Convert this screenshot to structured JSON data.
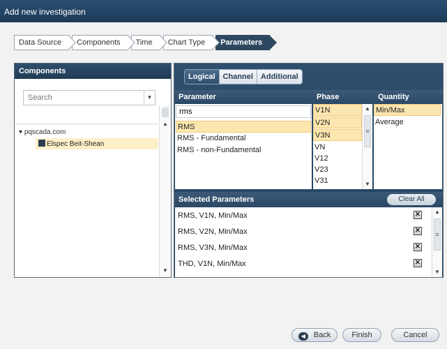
{
  "window": {
    "title": "Add new investigation"
  },
  "wizard": {
    "steps": [
      "Data Source",
      "Components",
      "Time",
      "Chart Type",
      "Parameters"
    ]
  },
  "components": {
    "title": "Components",
    "search_placeholder": "Search",
    "tree_root": "pqscada.com",
    "tree_child": "Elspec Beit-Shean"
  },
  "tabs": [
    "Logical",
    "Channel",
    "Additional"
  ],
  "grid": {
    "headers": {
      "parameter": "Parameter",
      "phase": "Phase",
      "quantity": "Quantity"
    },
    "filter_value": "rms",
    "parameters": [
      "RMS",
      "RMS - Fundamental",
      "RMS - non-Fundamental"
    ],
    "phases": [
      "V1N",
      "V2N",
      "V3N",
      "VN",
      "V12",
      "V23",
      "V31"
    ],
    "quantities": [
      "Min/Max",
      "Average"
    ]
  },
  "selected": {
    "title": "Selected Parameters",
    "clear_label": "Clear All",
    "rows": [
      "RMS, V1N, Min/Max",
      "RMS, V2N, Min/Max",
      "RMS, V3N, Min/Max",
      "THD, V1N, Min/Max"
    ]
  },
  "footer": {
    "back": "Back",
    "finish": "Finish",
    "cancel": "Cancel"
  }
}
